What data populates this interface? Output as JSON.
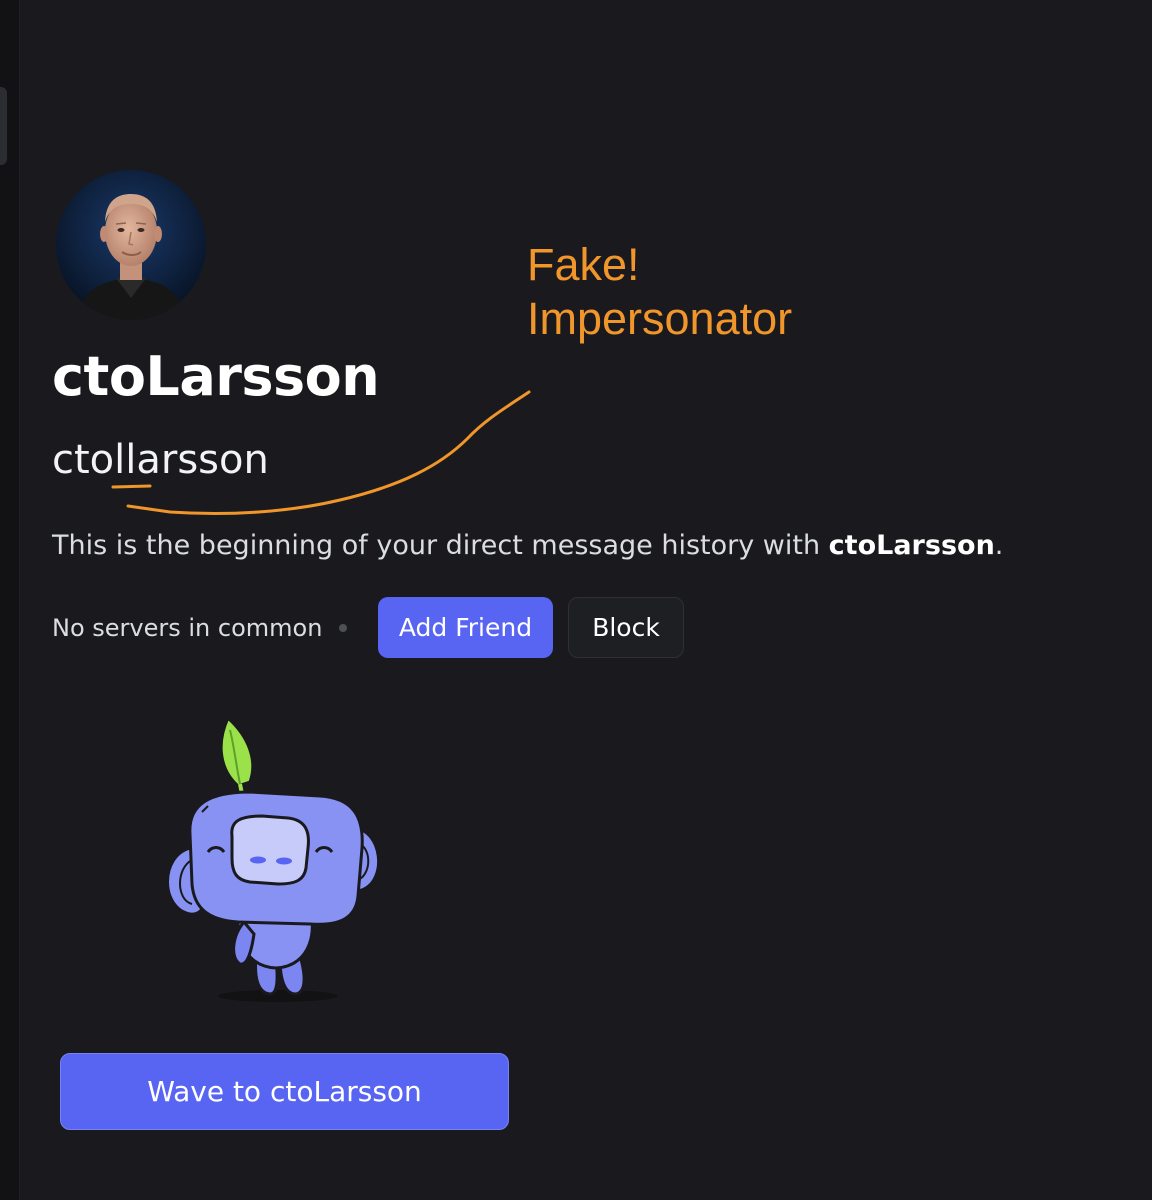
{
  "profile": {
    "display_name": "ctoLarsson",
    "username": "ctollarsson"
  },
  "intro": {
    "prefix": "This is the beginning of your direct message history with ",
    "name": "ctoLarsson",
    "suffix": "."
  },
  "mutual": {
    "servers_text": "No servers in common"
  },
  "actions": {
    "add_friend_label": "Add Friend",
    "block_label": "Block",
    "wave_label": "Wave to ctoLarsson"
  },
  "annotation": {
    "line1": "Fake!",
    "line2": "Impersonator",
    "color": "#f0962a"
  },
  "colors": {
    "background": "#1a1a1e",
    "blurple": "#5865f2",
    "block_button": "#1e1f22"
  },
  "icons": {
    "avatar": "profile-photo",
    "sticker": "wumpus-wave-sticker"
  }
}
